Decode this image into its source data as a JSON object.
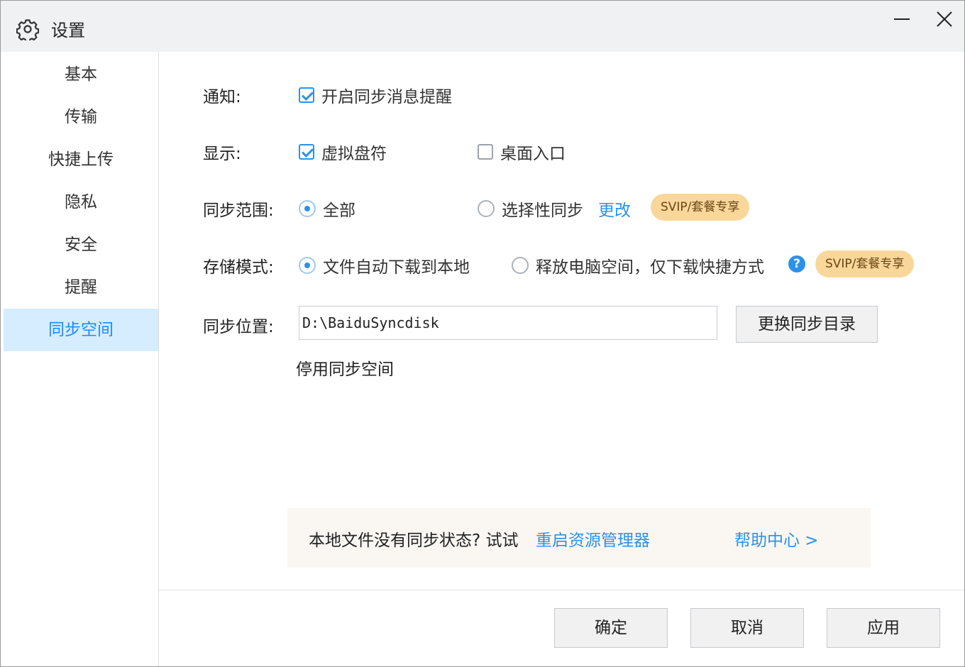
{
  "window": {
    "title": "设置"
  },
  "sidebar": {
    "items": [
      {
        "label": "基本"
      },
      {
        "label": "传输"
      },
      {
        "label": "快捷上传"
      },
      {
        "label": "隐私"
      },
      {
        "label": "安全"
      },
      {
        "label": "提醒"
      },
      {
        "label": "同步空间",
        "active": true
      }
    ]
  },
  "notify": {
    "label": "通知:",
    "option": {
      "label": "开启同步消息提醒",
      "checked": true
    }
  },
  "display": {
    "label": "显示:",
    "options": [
      {
        "label": "虚拟盘符",
        "checked": true
      },
      {
        "label": "桌面入口",
        "checked": false
      }
    ]
  },
  "sync_range": {
    "label": "同步范围:",
    "options": [
      {
        "label": "全部",
        "selected": true
      },
      {
        "label": "选择性同步",
        "selected": false
      }
    ],
    "change_link": "更改",
    "badge": "SVIP/套餐专享"
  },
  "storage_mode": {
    "label": "存储模式:",
    "options": [
      {
        "label": "文件自动下载到本地",
        "selected": true
      },
      {
        "label": "释放电脑空间，仅下载快捷方式",
        "selected": false
      }
    ],
    "help_icon": "?",
    "badge": "SVIP/套餐专享"
  },
  "sync_location": {
    "label": "同步位置:",
    "path": "D:\\BaiduSyncdisk",
    "change_button": "更换同步目录",
    "disable_link": "停用同步空间"
  },
  "tip": {
    "text": "本地文件没有同步状态? 试试",
    "action_link": "重启资源管理器",
    "help_link": "帮助中心 >"
  },
  "footer": {
    "ok": "确定",
    "cancel": "取消",
    "apply": "应用"
  },
  "colors": {
    "accent": "#2b91ea",
    "active_bg": "#d6ecff",
    "badge_bg": "#f9d79a",
    "titlebar_bg": "#f0f1f3"
  },
  "icons": {
    "title": "gear-icon",
    "minimize": "minimize-icon",
    "close": "close-icon",
    "help": "question-circle-icon"
  }
}
